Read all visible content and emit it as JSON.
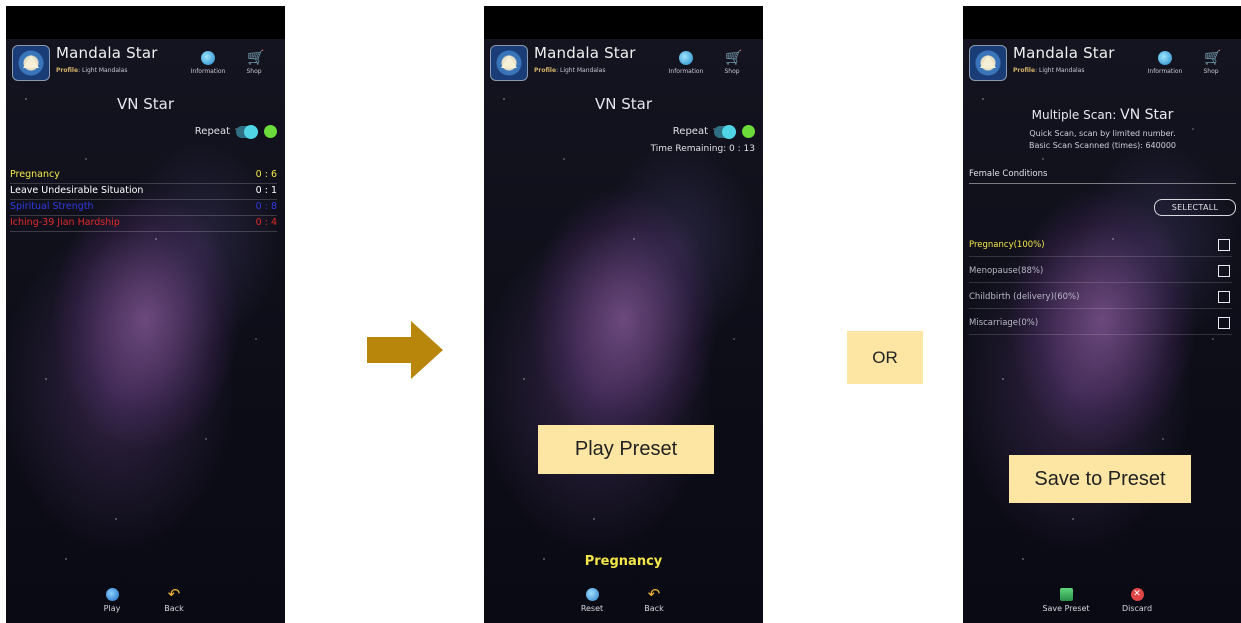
{
  "colors": {
    "yellow": "#f2e64a",
    "white": "#ffffff",
    "blue": "#2f3be0",
    "red": "#e12a2a",
    "callout_bg": "#fde6a3",
    "arrow": "#b8860b"
  },
  "app": {
    "title": "Mandala Star",
    "profile_label": "Profile",
    "profile_value": ": Light Mandalas",
    "info_label": "Information",
    "shop_label": "Shop"
  },
  "screen1": {
    "title": "VN Star",
    "repeat_label": "Repeat",
    "items": [
      {
        "label": "Pregnancy",
        "value": "0 : 6",
        "color": "#f2e64a"
      },
      {
        "label": "Leave Undesirable Situation",
        "value": "0 : 1",
        "color": "#ffffff"
      },
      {
        "label": "Spiritual Strength",
        "value": "0 : 8",
        "color": "#2f3be0"
      },
      {
        "label": "Iching-39 Jian Hardship",
        "value": "0 : 4",
        "color": "#e12a2a"
      }
    ],
    "play_label": "Play",
    "back_label": "Back"
  },
  "screen2": {
    "title": "VN Star",
    "repeat_label": "Repeat",
    "time_remaining": "Time Remaining: 0 : 13",
    "now_playing": "Pregnancy",
    "reset_label": "Reset",
    "back_label": "Back"
  },
  "screen3": {
    "title_prefix": "Multiple Scan:",
    "title_name": "VN Star",
    "subtitle1": "Quick Scan, scan by limited number.",
    "subtitle2": "Basic Scan Scanned (times): 640000",
    "section": "Female Conditions",
    "selectall": "SELECTALL",
    "items": [
      {
        "label": "Pregnancy(100%)",
        "color": "#f2e64a"
      },
      {
        "label": "Menopause(88%)",
        "color": "#b9b9c6"
      },
      {
        "label": "Childbirth (delivery)(60%)",
        "color": "#b9b9c6"
      },
      {
        "label": "Miscarriage(0%)",
        "color": "#b9b9c6"
      }
    ],
    "save_label": "Save Preset",
    "discard_label": "Discard"
  },
  "callouts": {
    "play_preset": "Play Preset",
    "or": "OR",
    "save_to_preset": "Save to Preset"
  }
}
